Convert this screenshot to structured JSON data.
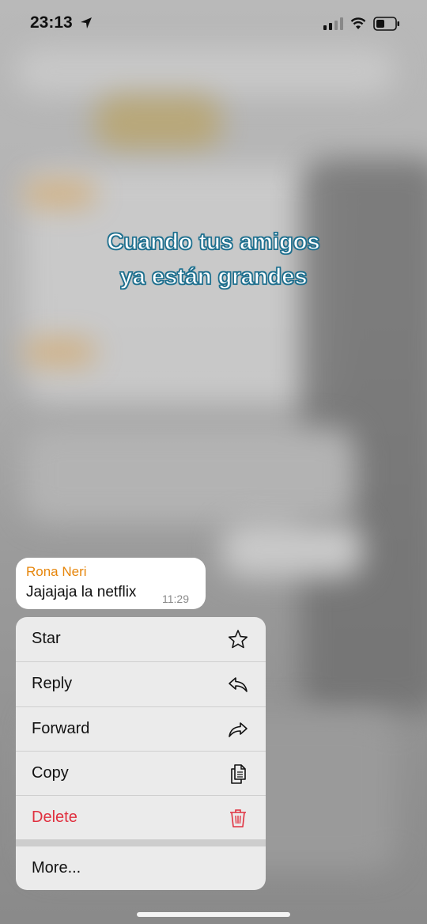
{
  "status_bar": {
    "time": "23:13"
  },
  "caption": {
    "line1": "Cuando tus amigos",
    "line2": "ya están grandes"
  },
  "message": {
    "sender": "Rona Neri",
    "text": "Jajajaja la netflix",
    "time": "11:29"
  },
  "menu": {
    "items": [
      {
        "label": "Star",
        "icon": "star-icon"
      },
      {
        "label": "Reply",
        "icon": "reply-icon"
      },
      {
        "label": "Forward",
        "icon": "forward-icon"
      },
      {
        "label": "Copy",
        "icon": "copy-icon"
      },
      {
        "label": "Delete",
        "icon": "trash-icon"
      },
      {
        "label": "More..."
      }
    ]
  },
  "colors": {
    "sender": "#e6860c",
    "delete": "#e0303f",
    "caption_outline": "#1d6f8e"
  }
}
